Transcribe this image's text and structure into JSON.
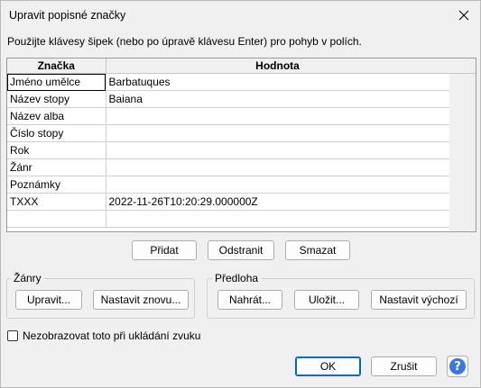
{
  "window": {
    "title": "Upravit popisné značky"
  },
  "instruction": "Použijte klávesy šipek (nebo po úpravě klávesu Enter) pro pohyb v polích.",
  "table": {
    "headers": [
      "Značka",
      "Hodnota"
    ],
    "rows": [
      {
        "tag": "Jméno umělce",
        "value": "Barbatuques"
      },
      {
        "tag": "Název stopy",
        "value": "Baiana"
      },
      {
        "tag": "Název alba",
        "value": ""
      },
      {
        "tag": "Číslo stopy",
        "value": ""
      },
      {
        "tag": "Rok",
        "value": ""
      },
      {
        "tag": "Žánr",
        "value": ""
      },
      {
        "tag": "Poznámky",
        "value": ""
      },
      {
        "tag": "TXXX",
        "value": "2022-11-26T10:20:29.000000Z"
      },
      {
        "tag": "",
        "value": ""
      }
    ]
  },
  "row_buttons": {
    "add": "Přidat",
    "remove": "Odstranit",
    "clear": "Smazat"
  },
  "genres": {
    "label": "Žánry",
    "edit": "Upravit...",
    "reset": "Nastavit znovu..."
  },
  "template": {
    "label": "Předloha",
    "load": "Nahrát...",
    "save": "Uložit...",
    "set_default": "Nastavit výchozí"
  },
  "checkbox": {
    "label": "Nezobrazovat toto při ukládání zvuku",
    "checked": false
  },
  "footer": {
    "ok": "OK",
    "cancel": "Zrušit",
    "help": "?"
  },
  "colors": {
    "accent": "#0067c0",
    "help": "#3b78d8"
  }
}
